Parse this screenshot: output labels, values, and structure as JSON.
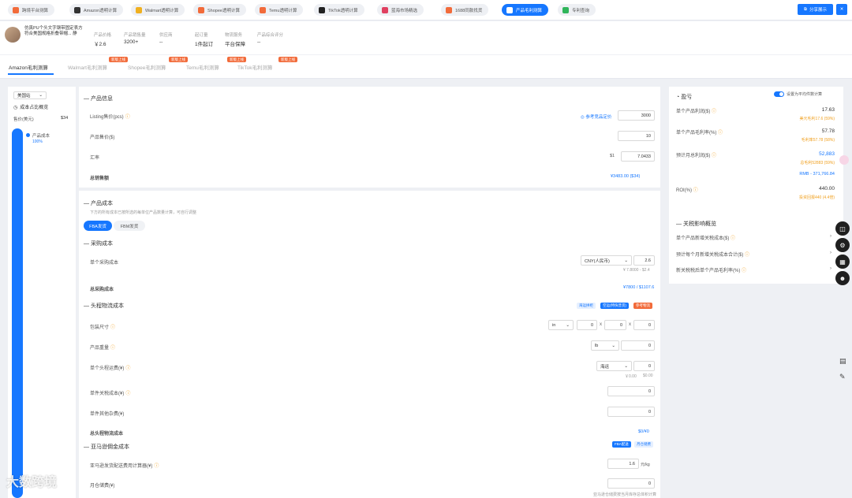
{
  "topbar": {
    "pills": [
      {
        "label": "跨境平台测算",
        "color": "#f26b3a"
      },
      {
        "label": "Amazon透明计算",
        "color": "#333333"
      },
      {
        "label": "Walmart透明计算",
        "color": "#f0b020"
      },
      {
        "label": "Shopee透明计算",
        "color": "#f26b3a"
      },
      {
        "label": "Temu透明计算",
        "color": "#f26b3a"
      },
      {
        "label": "TikTok透明计算",
        "color": "#222222"
      },
      {
        "label": "蓝海市场精选",
        "color": "#e04060"
      },
      {
        "label": "1688同款找货",
        "color": "#f26b3a"
      },
      {
        "label": "产品毛利测算",
        "color": "#1677ff"
      },
      {
        "label": "专利查询",
        "color": "#2fb55a"
      }
    ],
    "share_label": "分享展示",
    "close_label": "✕"
  },
  "product": {
    "title": "仿真PU个头文字钢带固定表方 符合美国规格折叠带帽... 静",
    "stats": [
      {
        "label": "产品价格",
        "value": "￥2.6"
      },
      {
        "label": "产品销售量",
        "value": "3200+"
      },
      {
        "label": "供应商",
        "value": "--"
      },
      {
        "label": "起订量",
        "value": "1件起订"
      },
      {
        "label": "物流服务",
        "value": "平台保障"
      },
      {
        "label": "产品综合评分",
        "value": "--"
      }
    ]
  },
  "tabs": [
    {
      "label": "Amazon毛利测算",
      "badge": ""
    },
    {
      "label": "Walmart毛利测算",
      "badge": "新版上线"
    },
    {
      "label": "Shopee毛利测算",
      "badge": "新版上线"
    },
    {
      "label": "Temu毛利测算",
      "badge": "新版上线"
    },
    {
      "label": "TikTok毛利测算",
      "badge": "新版上线"
    }
  ],
  "left": {
    "region_select": "美国站",
    "cost_title": "成本占比概览",
    "total_label": "售价(美元)",
    "total_value": "$34",
    "legend_label": "产品成本",
    "legend_pct": "100%",
    "progress_fraction": 1.0
  },
  "product_info": {
    "title": "产品信息",
    "listing_price_label": "Listing售价(pcs)",
    "listing_link": "参考竞品定价",
    "listing_value": "3000",
    "unit_price_label": "产品售价($)",
    "unit_price_value": "10",
    "rate_label": "汇率",
    "rate_prefix": "$1",
    "rate_value": "7.0433",
    "total_label": "总销售额",
    "total_value": "¥3483.00 ($34)"
  },
  "cost": {
    "title": "产品成本",
    "hint": "下方的所有成本已按所选的每单位产品数量计算，可自行调整",
    "seg_fba": "FBA发货",
    "seg_fbm": "FBM发货",
    "purchase_title": "采购成本",
    "purchase_label": "单个采购成本",
    "currency": "CNY(人民币)",
    "purchase_value": "2.6",
    "purchase_sub": "¥ 7.8000 - $2.4",
    "purchase_total_label": "总采购成本",
    "purchase_total_value": "¥7800 / $1107.6",
    "shipping_title": "头程物流成本",
    "ship_btn1": "海运拼柜",
    "ship_btn2": "空运(特快普货)",
    "ship_btn3": "参考物流",
    "package_label": "包装尺寸",
    "unit_in": "in",
    "dim1": "0",
    "dim2": "0",
    "dim3": "0",
    "x_sep": "x",
    "weight_label": "产品重量",
    "unit_lb": "lb",
    "weight_value": "0",
    "freight_label": "单个头程运费(¥)",
    "freight_select": "海运",
    "freight_value": "0",
    "freight_sub1": "￥0.00",
    "freight_sub2": "$0.00",
    "tariff_label": "单件关税成本(¥)",
    "tariff_value": "0",
    "other_label": "单件其他杂费(¥)",
    "other_value": "0",
    "ship_total_label": "总头程物流成本",
    "ship_total_value": "$0/¥0",
    "platform_title": "亚马逊佣金成本",
    "plat_btn1": "FBA配送",
    "plat_btn2": "月仓储费",
    "fba_fee_label": "亚马逊发货配送费用计算器(¥)",
    "fba_fee_value": "1.6",
    "fba_fee_unit": "元/kg",
    "storage_label": "月仓储费(¥)",
    "storage_value": "0",
    "storage_note": "亚马逊仓储费按当月库存总体积计算"
  },
  "right": {
    "title": "盈亏",
    "toggle_label": "设置为平均件数计算",
    "rows": [
      {
        "label": "单个产品利润($)",
        "value": "17.63",
        "sub": "美元毛利17.6 (59%)"
      },
      {
        "label": "单个产品毛利率(%)",
        "value": "57.78",
        "sub": "毛利率57.78 (58%)"
      },
      {
        "label": "预计月总利润($)",
        "value": "52,883",
        "sub": "总毛利52883 (59%)",
        "sub2": "RMB - 371,766.84"
      },
      {
        "label": "ROI(%)",
        "value": "440.00",
        "sub": "投资回报440 (4.4倍)"
      }
    ],
    "impact_title": "关税影响概览",
    "impact_rows": [
      "单个产品新增关税成本($)",
      "预计每个月新增关税成本合计($)",
      "新关税税后单个产品毛利率(%)"
    ]
  },
  "watermark": "大数跨境",
  "colors": {
    "accent": "#1677ff",
    "badge": "#f26b3a",
    "warn": "#f0a020"
  }
}
